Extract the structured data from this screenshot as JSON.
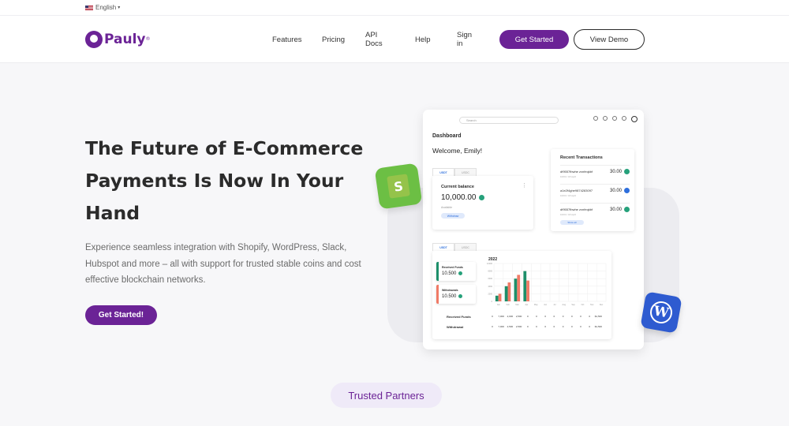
{
  "lang_bar": {
    "language": "English",
    "caret": "▾"
  },
  "header": {
    "logo_text": "Pauly",
    "logo_reg": "®",
    "nav": {
      "features": "Features",
      "pricing": "Pricing",
      "api_docs": "API Docs",
      "help": "Help",
      "sign_in": "Sign in"
    },
    "get_started": "Get Started",
    "view_demo": "View Demo"
  },
  "hero": {
    "title_line1": "The Future of E-Commerce",
    "title_line2": "Payments Is Now In Your",
    "title_line3": "Hand",
    "description": "Experience seamless integration with Shopify, WordPress, Slack, Hubspot and more – all with support for trusted stable coins and cost effective blockchain networks.",
    "cta": "Get Started!"
  },
  "dashboard": {
    "search_placeholder": "Search",
    "title": "Dashboard",
    "welcome": "Welcome, Emily!",
    "tabs_top": [
      "USDT",
      "USDC"
    ],
    "balance": {
      "label": "Current balance",
      "amount": "10,000.00",
      "sub": "Available",
      "chip": "Withdraw"
    },
    "recent_tx": {
      "title": "Recent Transactions",
      "rows": [
        {
          "addr": "df9557fbwhe zxnfeqkbf",
          "date": "10/04 / 18 April",
          "amount": "30.00",
          "coin": "usdt"
        },
        {
          "addr": "a1e2f4ghe9874283097",
          "date": "10/04 / 18 April",
          "amount": "30.00",
          "coin": "usdc"
        },
        {
          "addr": "df9557fbwhe zxnfeqkbf",
          "date": "10/04 / 18 April",
          "amount": "30.00",
          "coin": "usdt"
        }
      ],
      "show_all": "Show all"
    },
    "tabs_bottom": [
      "USDT",
      "USDC"
    ],
    "received_card": {
      "title": "Received Funds",
      "value": "10.500"
    },
    "withdrawals_card": {
      "title": "Withdrawals",
      "value": "10.500"
    },
    "chart_year": "2022",
    "table": {
      "received_label": "Received Funds",
      "withdrawal_label": "Withdrawal",
      "received_values": [
        "0",
        "7,000",
        "2,000",
        "2,500",
        "0",
        "0",
        "0",
        "0",
        "0",
        "0",
        "0",
        "0",
        "$1,500"
      ],
      "withdrawal_values": [
        "0",
        "7,000",
        "2,500",
        "2,500",
        "0",
        "0",
        "0",
        "0",
        "0",
        "0",
        "0",
        "0",
        "$1,500"
      ]
    }
  },
  "chart_data": {
    "type": "bar",
    "title": "2022",
    "categories": [
      "Jan",
      "Feb",
      "Mar",
      "Apr",
      "May",
      "Jun",
      "Jul",
      "Aug",
      "Sep",
      "Oct",
      "Nov",
      "Dec"
    ],
    "series": [
      {
        "name": "Received Funds",
        "color": "#1d8f6a",
        "values": [
          1500,
          4000,
          6000,
          8000,
          0,
          0,
          0,
          0,
          0,
          0,
          0,
          0
        ]
      },
      {
        "name": "Withdrawals",
        "color": "#f07a66",
        "values": [
          2000,
          5000,
          7000,
          5500,
          0,
          0,
          0,
          0,
          0,
          0,
          0,
          0
        ]
      }
    ],
    "ylim": [
      0,
      10000
    ]
  },
  "partners": {
    "label": "Trusted Partners"
  },
  "colors": {
    "brand": "#6b2396",
    "usdt": "#26a17b",
    "usdc": "#2e6fdc",
    "shopify": "#6cbf44",
    "wordpress": "#2e5bd0"
  },
  "icons": [
    "flag-us-icon",
    "pauly-logo-icon",
    "shopify-icon",
    "wordpress-icon",
    "bell-icon",
    "info-icon",
    "refresh-icon",
    "settings-icon",
    "user-icon",
    "search-icon"
  ]
}
